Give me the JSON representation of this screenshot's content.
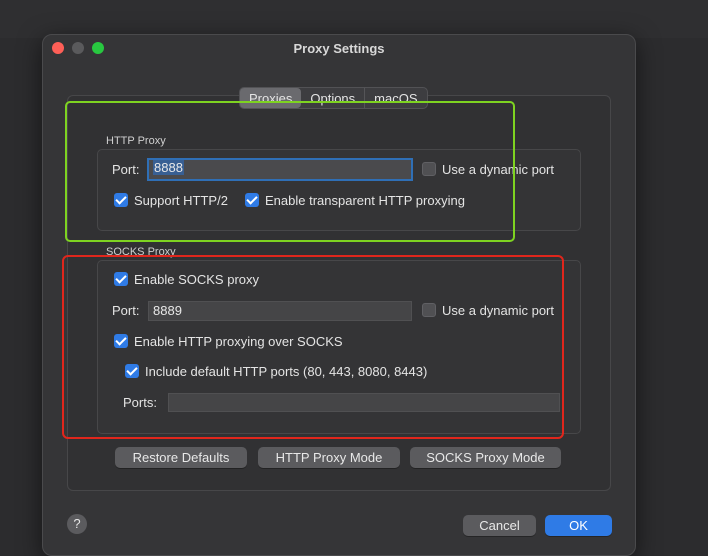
{
  "window": {
    "title": "Proxy Settings"
  },
  "tabs": [
    "Proxies",
    "Options",
    "macOS"
  ],
  "http_proxy": {
    "group_label": "HTTP Proxy",
    "port_label": "Port:",
    "port_value": "8888",
    "dynamic_port_label": "Use a dynamic port",
    "dynamic_port_checked": false,
    "http2_label": "Support HTTP/2",
    "http2_checked": true,
    "transparent_label": "Enable transparent HTTP proxying",
    "transparent_checked": true
  },
  "socks_proxy": {
    "group_label": "SOCKS Proxy",
    "enable_label": "Enable SOCKS proxy",
    "enable_checked": true,
    "port_label": "Port:",
    "port_value": "8889",
    "dynamic_port_label": "Use a dynamic port",
    "dynamic_port_checked": false,
    "http_over_socks_label": "Enable HTTP proxying over SOCKS",
    "http_over_socks_checked": true,
    "include_default_label": "Include default HTTP ports (80, 443, 8080, 8443)",
    "include_default_checked": true,
    "ports_label": "Ports:",
    "ports_value": ""
  },
  "buttons": {
    "restore_defaults": "Restore Defaults",
    "http_proxy_mode": "HTTP Proxy Mode",
    "socks_proxy_mode": "SOCKS Proxy Mode",
    "help": "?",
    "cancel": "Cancel",
    "ok": "OK"
  },
  "colors": {
    "accent": "#2f7be6",
    "highlight_green": "#7ed321",
    "highlight_red": "#e0261c"
  }
}
